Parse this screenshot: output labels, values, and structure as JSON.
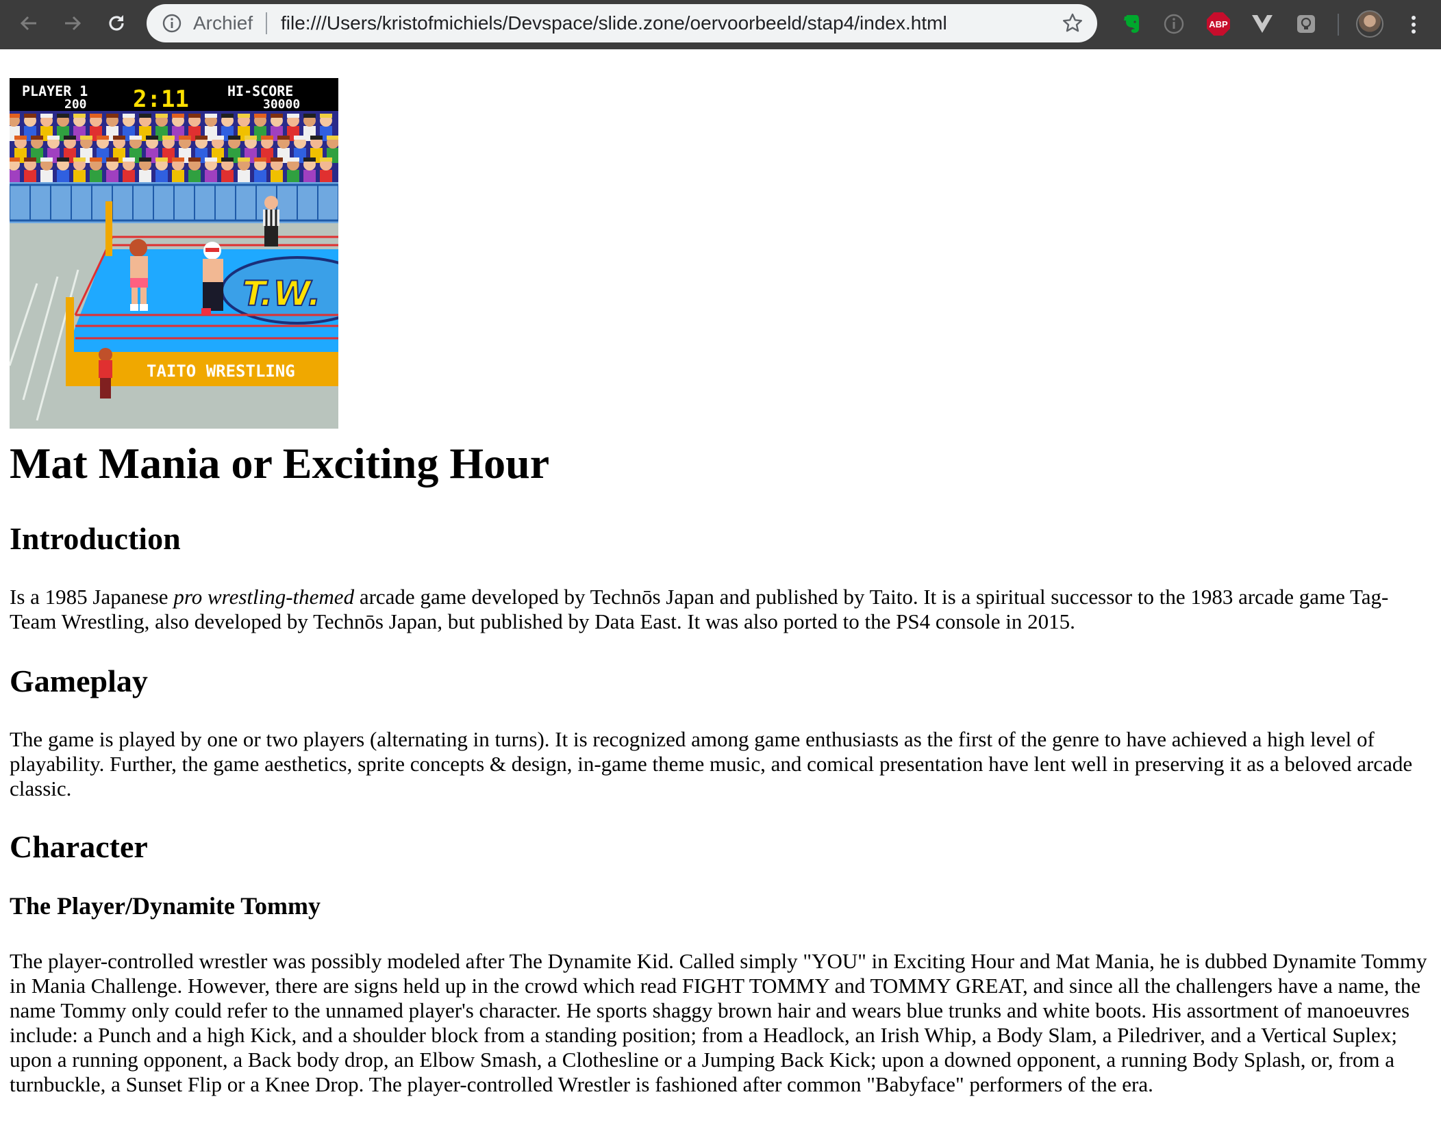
{
  "browser": {
    "archive_chip": "Archief",
    "url": "file:///Users/kristofmichiels/Devspace/slide.zone/oervoorbeeld/stap4/index.html",
    "abp_label": "ABP"
  },
  "game_screen": {
    "player_label": "PLAYER 1",
    "player_score": "200",
    "timer": "2:11",
    "hiscore_label": "HI-SCORE",
    "hiscore_value": "30000",
    "ring_logo": "T.W.",
    "apron_text": "TAITO  WRESTLING"
  },
  "article": {
    "title": "Mat Mania or Exciting Hour",
    "intro_heading": "Introduction",
    "intro_before": "Is a 1985 Japanese ",
    "intro_em": "pro wrestling-themed",
    "intro_after": " arcade game developed by Technōs Japan and published by Taito. It is a spiritual successor to the 1983 arcade game Tag-Team Wrestling, also developed by Technōs Japan, but published by Data East. It was also ported to the PS4 console in 2015.",
    "gameplay_heading": "Gameplay",
    "gameplay_text": "The game is played by one or two players (alternating in turns). It is recognized among game enthusiasts as the first of the genre to have achieved a high level of playability. Further, the game aesthetics, sprite concepts & design, in-game theme music, and comical presentation have lent well in preserving it as a beloved arcade classic.",
    "character_heading": "Character",
    "player_heading": "The Player/Dynamite Tommy",
    "player_text": "The player-controlled wrestler was possibly modeled after The Dynamite Kid. Called simply \"YOU\" in Exciting Hour and Mat Mania, he is dubbed Dynamite Tommy in Mania Challenge. However, there are signs held up in the crowd which read FIGHT TOMMY and TOMMY GREAT, and since all the challengers have a name, the name Tommy only could refer to the unnamed player's character. He sports shaggy brown hair and wears blue trunks and white boots. His assortment of manoeuvres include: a Punch and a high Kick, and a shoulder block from a standing position; from a Headlock, an Irish Whip, a Body Slam, a Piledriver, and a Vertical Suplex; upon a running opponent, a Back body drop, an Elbow Smash, a Clothesline or a Jumping Back Kick; upon a downed opponent, a running Body Splash, or, from a turnbuckle, a Sunset Flip or a Knee Drop. The player-controlled Wrestler is fashioned after common \"Babyface\" performers of the era."
  },
  "colors": {
    "chrome_bg": "#3c3c3c",
    "omnibox_bg": "#f1f3f4",
    "ring_mat": "#1fa9ff",
    "apron": "#f0a800",
    "score_yellow": "#ffe000"
  },
  "icons": [
    "back-arrow-icon",
    "forward-arrow-icon",
    "reload-icon",
    "info-icon",
    "star-icon",
    "evernote-icon",
    "extension-info-icon",
    "adblock-plus-icon",
    "vue-devtools-icon",
    "lightbulb-extension-icon",
    "profile-avatar",
    "menu-dots-icon"
  ]
}
